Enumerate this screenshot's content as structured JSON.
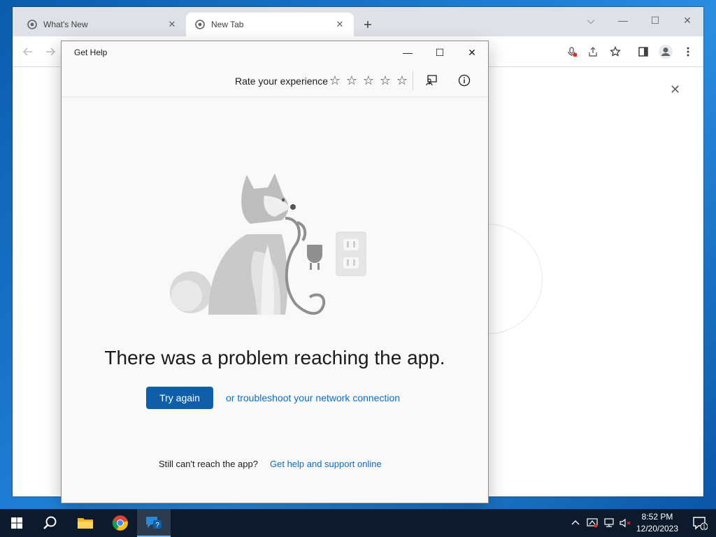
{
  "browser": {
    "tabs": [
      {
        "title": "What's New",
        "close": "✕"
      },
      {
        "title": "New Tab",
        "close": "✕"
      }
    ],
    "newtab_symbol": "+",
    "window_controls": {
      "dropdown": "⌵",
      "minimize": "—",
      "maximize": "☐",
      "close": "✕"
    },
    "toolbar_icons": [
      "back-arrow-icon",
      "forward-arrow-icon",
      "mic-blocked-icon",
      "share-icon",
      "bookmark-star-icon",
      "side-panel-icon",
      "profile-icon",
      "menu-icon"
    ],
    "ntp_close": "✕"
  },
  "get_help": {
    "title": "Get Help",
    "window_controls": {
      "minimize": "—",
      "maximize": "☐",
      "close": "✕"
    },
    "rate_label": "Rate your experience",
    "stars": [
      "☆",
      "☆",
      "☆",
      "☆",
      "☆"
    ],
    "error_title": "There was a problem reaching the app.",
    "try_again": "Try again",
    "troubleshoot": "or troubleshoot your network connection",
    "still_cant": "Still can't reach the app?",
    "help_online": "Get help and support online",
    "colors": {
      "button": "#0f5ea8",
      "link": "#0f6cbd"
    }
  },
  "taskbar": {
    "time": "8:52 PM",
    "date": "12/20/2023",
    "notification_count": "1",
    "apps": [
      "start-icon",
      "search-icon",
      "file-explorer-icon",
      "chrome-icon",
      "get-help-icon"
    ]
  }
}
